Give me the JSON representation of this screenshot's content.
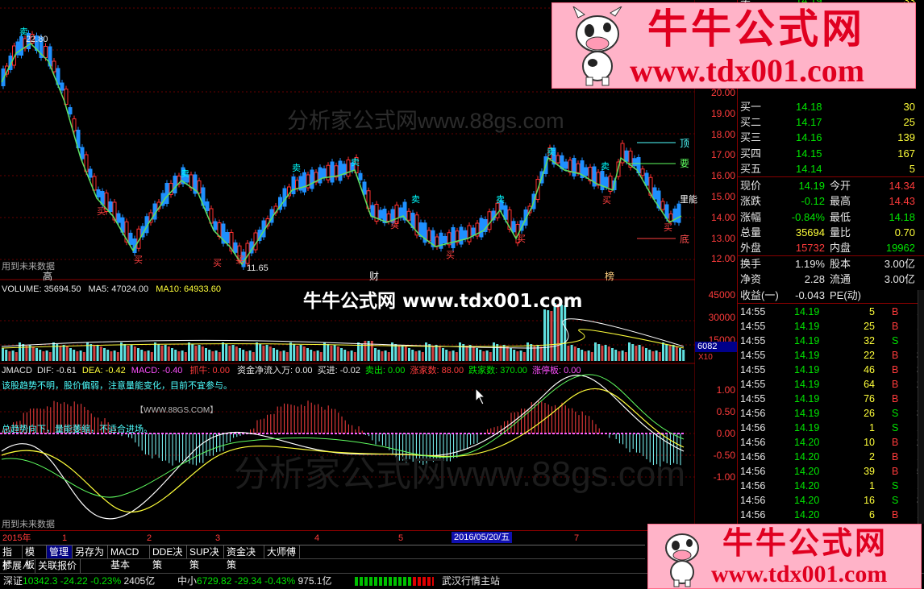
{
  "chart": {
    "price_high_label": "22.80",
    "price_low_label": "11.65",
    "future_data_note": "用到未来数据",
    "watermark": "分析家公式网www.88gs.com",
    "markers": {
      "high": "高",
      "cai": "财",
      "bang": "榜"
    },
    "signal_labels": {
      "sell": "卖",
      "buy": "买",
      "top": "顶",
      "bottom": "底",
      "target": "要",
      "li": "里能"
    },
    "price_scale": [
      "20.00",
      "19.00",
      "18.00",
      "17.00",
      "16.00",
      "15.00",
      "14.00",
      "13.00",
      "12.00"
    ],
    "volume_header": {
      "volume": "VOLUME: 35694.50",
      "ma5": "MA5: 47024.00",
      "ma10": "MA10: 64933.60"
    },
    "volume_scale": [
      "45000",
      "30000",
      "15000"
    ],
    "volume_box": "6082",
    "volume_unit": "X10",
    "center_banner": "牛牛公式网 www.tdx001.com",
    "macd_header": {
      "name": "JMACD",
      "dif": "DIF: -0.61",
      "dea": "DEA: -0.42",
      "macd": "MACD: -0.40",
      "zhuaniu": "抓牛: 0.00",
      "fund": "资金净流入万: 0.00",
      "buyin": "买进: -0.02",
      "sellout": "卖出: 0.00",
      "zhangjia": "涨家数: 88.00",
      "diejia": "跌家数: 370.00",
      "zhangting": "涨停板: 0.00"
    },
    "macd_note1": "该股趋势不明，股价偏弱，注意量能变化，目前不宜参与。",
    "macd_note2": "总趋势向下，量能萎缩，不适合进场。",
    "macd_watermark": "【WWW.88GS.COM】",
    "macd_scale": [
      "1.00",
      "0.50",
      "0.00",
      "-0.50",
      "-1.00"
    ],
    "date_axis": {
      "year": "2015年",
      "months": [
        "1",
        "2",
        "3",
        "4",
        "5",
        "7"
      ],
      "cursor": "2016/05/20/五"
    }
  },
  "quote": {
    "bids": [
      {
        "label": "买一",
        "price": "14.18",
        "vol": "30"
      },
      {
        "label": "买二",
        "price": "14.17",
        "vol": "25"
      },
      {
        "label": "买三",
        "price": "14.16",
        "vol": "139"
      },
      {
        "label": "买四",
        "price": "14.15",
        "vol": "167"
      },
      {
        "label": "买五",
        "price": "14.14",
        "vol": "5"
      }
    ],
    "top_partial": {
      "label": "买",
      "price": "14.19",
      "vol": "33"
    },
    "stats": [
      {
        "l1": "现价",
        "v1": "14.19",
        "c1": "grn",
        "l2": "今开",
        "v2": "14.34",
        "c2": "red"
      },
      {
        "l1": "涨跌",
        "v1": "-0.12",
        "c1": "grn",
        "l2": "最高",
        "v2": "14.43",
        "c2": "red"
      },
      {
        "l1": "涨幅",
        "v1": "-0.84%",
        "c1": "grn",
        "l2": "最低",
        "v2": "14.18",
        "c2": "grn"
      },
      {
        "l1": "总量",
        "v1": "35694",
        "c1": "yel",
        "l2": "量比",
        "v2": "0.70",
        "c2": "yel"
      },
      {
        "l1": "外盘",
        "v1": "15732",
        "c1": "red",
        "l2": "内盘",
        "v2": "19962",
        "c2": "grn"
      }
    ],
    "fundamentals": [
      {
        "l1": "换手",
        "v1": "1.19%",
        "l2": "股本",
        "v2": "3.00亿"
      },
      {
        "l1": "净资",
        "v1": "2.28",
        "l2": "流通",
        "v2": "3.00亿"
      },
      {
        "l1": "收益(一)",
        "v1": "-0.043",
        "l2": "PE(动)",
        "v2": ""
      }
    ]
  },
  "ticks": [
    {
      "time": "14:55",
      "price": "14.19",
      "vol": "5",
      "side": "B",
      "n": "1"
    },
    {
      "time": "14:55",
      "price": "14.19",
      "vol": "25",
      "side": "B",
      "n": "1"
    },
    {
      "time": "14:55",
      "price": "14.19",
      "vol": "32",
      "side": "S",
      "n": "1"
    },
    {
      "time": "14:55",
      "price": "14.19",
      "vol": "22",
      "side": "B",
      "n": "3"
    },
    {
      "time": "14:55",
      "price": "14.19",
      "vol": "46",
      "side": "B",
      "n": "3"
    },
    {
      "time": "14:55",
      "price": "14.19",
      "vol": "64",
      "side": "B",
      "n": "2"
    },
    {
      "time": "14:55",
      "price": "14.19",
      "vol": "76",
      "side": "B",
      "n": "1"
    },
    {
      "time": "14:56",
      "price": "14.19",
      "vol": "26",
      "side": "S",
      "n": "3"
    },
    {
      "time": "14:56",
      "price": "14.19",
      "vol": "1",
      "side": "S",
      "n": "1"
    },
    {
      "time": "14:56",
      "price": "14.20",
      "vol": "10",
      "side": "B",
      "n": "2"
    },
    {
      "time": "14:56",
      "price": "14.20",
      "vol": "2",
      "side": "B",
      "n": "1"
    },
    {
      "time": "14:56",
      "price": "14.20",
      "vol": "39",
      "side": "B",
      "n": "5"
    },
    {
      "time": "14:56",
      "price": "14.20",
      "vol": "1",
      "side": "S",
      "n": "1"
    },
    {
      "time": "14:56",
      "price": "14.20",
      "vol": "16",
      "side": "S",
      "n": "3"
    },
    {
      "time": "14:56",
      "price": "14.20",
      "vol": "6",
      "side": "B",
      "n": "1"
    }
  ],
  "tabs": [
    "指标",
    "模板",
    "管理",
    "另存为",
    "MACD基本",
    "DDE决策",
    "SUP决策",
    "资金决策",
    "大师傅"
  ],
  "tabs2": [
    "扩展∧",
    "关联报价"
  ],
  "status": {
    "sh_name": "深证",
    "sh_val": "10342.3",
    "sh_chg": "-24.22",
    "sh_pct": "-0.23%",
    "sh_amt": "2405亿",
    "zx_name": "中小",
    "zx_val": "6729.82",
    "zx_chg": "-29.34",
    "zx_pct": "-0.43%",
    "zx_amt": "975.1亿",
    "server": "武汉行情主站"
  },
  "ads": {
    "title": "牛牛公式网",
    "url": "www.tdx001.com"
  }
}
